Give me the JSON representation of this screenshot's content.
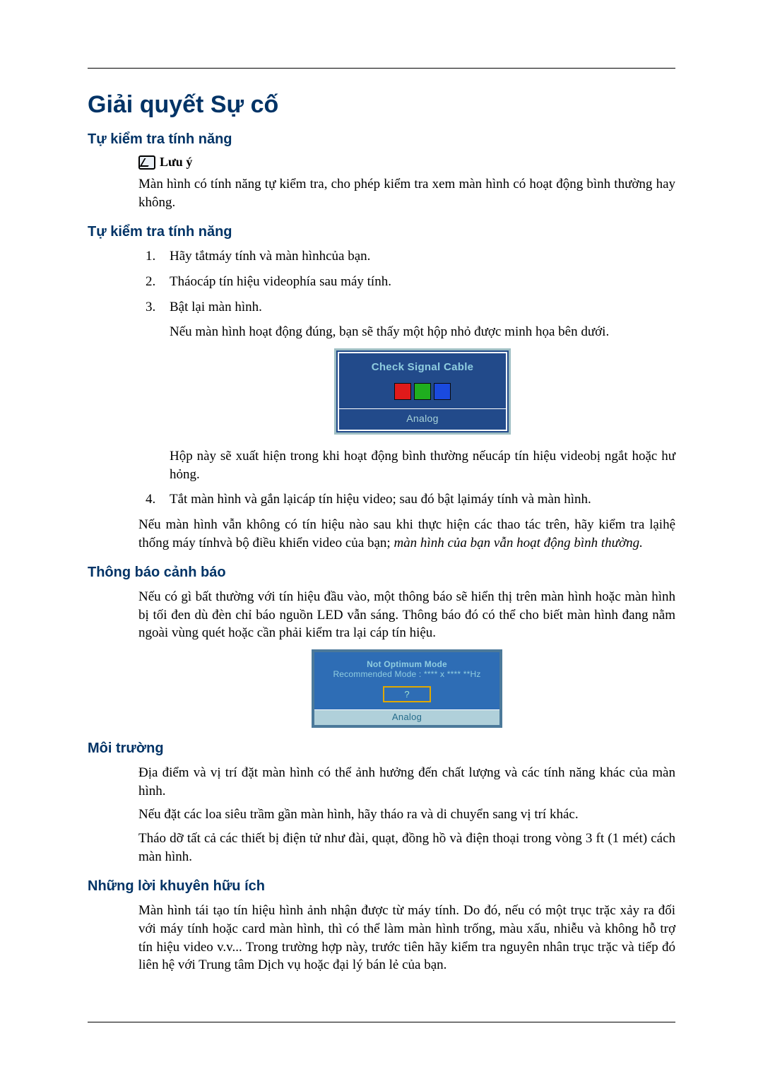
{
  "title": "Giải quyết Sự cố",
  "section1": {
    "heading": "Tự kiểm tra tính năng",
    "note_label": "Lưu ý",
    "note_text": "Màn hình có tính năng tự kiểm tra, cho phép kiểm tra xem màn hình có hoạt động bình thường hay không."
  },
  "section2": {
    "heading": "Tự kiểm tra tính năng",
    "items": [
      "Hãy tắtmáy tính và màn hìnhcủa bạn.",
      "Tháocáp tín hiệu videophía sau máy tính.",
      "Bật lại màn hình."
    ],
    "after3": "Nếu màn hình hoạt động đúng, bạn sẽ thấy một hộp nhỏ được minh họa bên dưới.",
    "fig1": {
      "title": "Check Signal Cable",
      "footer": "Analog"
    },
    "after_fig1": "Hộp này sẽ xuất hiện trong khi hoạt động bình thường nếucáp tín hiệu videobị ngắt hoặc hư hỏng.",
    "item4": "Tắt màn hình và gắn lạicáp tín hiệu video; sau đó bật lạimáy tính và màn hình.",
    "closing_plain": "Nếu màn hình vẫn không có tín hiệu nào sau khi thực hiện các thao tác trên, hãy kiểm tra lạihệ thống máy tínhvà bộ điều khiển video của bạn; ",
    "closing_italic": "màn hình của bạn vẫn hoạt động bình thường."
  },
  "section3": {
    "heading": "Thông báo cảnh báo",
    "text": "Nếu có gì bất thường với tín hiệu đầu vào, một thông báo sẽ hiển thị trên màn hình hoặc màn hình bị tối đen dù đèn chỉ báo nguồn LED vẫn sáng. Thông báo đó có thể cho biết màn hình đang nằm ngoài vùng quét hoặc cần phải kiểm tra lại cáp tín hiệu.",
    "fig2": {
      "line1": "Not Optimum Mode",
      "line2": "Recommended Mode : **** x ****  **Hz",
      "q": "?",
      "footer": "Analog"
    }
  },
  "section4": {
    "heading": "Môi trường",
    "p1": "Địa điểm và vị trí đặt màn hình có thể ảnh hưởng đến chất lượng và các tính năng khác của màn hình.",
    "p2": "Nếu đặt các loa siêu trầm gần màn hình, hãy tháo ra và di chuyển sang vị trí khác.",
    "p3": "Tháo dỡ tất cả các thiết bị điện tử như đài, quạt, đồng hồ và điện thoại trong vòng 3 ft (1 mét) cách màn hình."
  },
  "section5": {
    "heading": "Những lời khuyên hữu ích",
    "text": "Màn hình tái tạo tín hiệu hình ảnh nhận được từ máy tính. Do đó, nếu có một trục trặc xảy ra đối với máy tính hoặc card màn hình, thì có thể làm màn hình trống, màu xấu, nhiễu và không hỗ trợ tín hiệu video v.v... Trong trường hợp này, trước tiên hãy kiểm tra nguyên nhân trục trặc và tiếp đó liên hệ với Trung tâm Dịch vụ hoặc đại lý bán lẻ của bạn."
  }
}
